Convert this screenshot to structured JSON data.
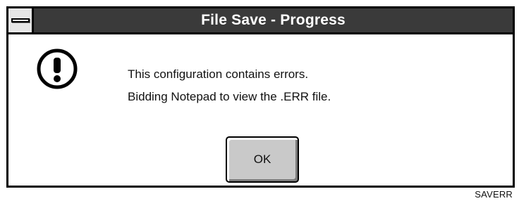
{
  "window": {
    "title": "File Save - Progress"
  },
  "icons": {
    "system_menu": "system-menu-icon",
    "alert": "exclamation-icon"
  },
  "message": {
    "line1": "This configuration contains errors.",
    "line2": "Bidding Notepad to view the .ERR file."
  },
  "buttons": {
    "ok_label": "OK"
  },
  "caption": "SAVERR",
  "colors": {
    "titlebar": "#3a3a3a",
    "title_text": "#ffffff",
    "button_face": "#c9c9c9"
  }
}
